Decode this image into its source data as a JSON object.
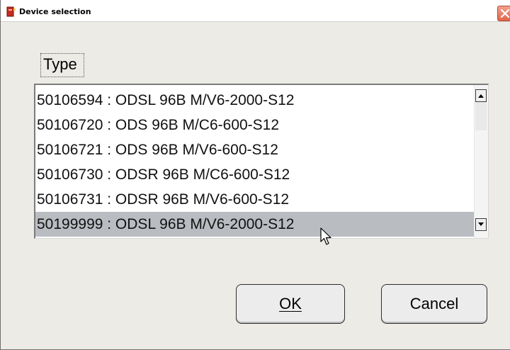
{
  "window": {
    "title": "Device selection"
  },
  "type_label": "Type",
  "list": {
    "items": [
      "50106594 : ODSL 96B M/V6-2000-S12",
      "50106720 : ODS 96B M/C6-600-S12",
      "50106721 : ODS 96B M/V6-600-S12",
      "50106730 : ODSR 96B M/C6-600-S12",
      "50106731 : ODSR 96B M/V6-600-S12",
      "50199999 : ODSL 96B M/V6-2000-S12"
    ],
    "selected_index": 5
  },
  "buttons": {
    "ok_label": "OK",
    "cancel_label": "Cancel"
  },
  "icons": {
    "title_icon": "app-icon",
    "close": "close-icon",
    "scroll_up": "scroll-up-arrow-icon",
    "scroll_down": "scroll-down-arrow-icon",
    "cursor": "mouse-pointer-icon"
  },
  "colors": {
    "selection": "#b9bcc1",
    "close_button": "#e0664b",
    "dialog_background": "#ecebe6"
  }
}
